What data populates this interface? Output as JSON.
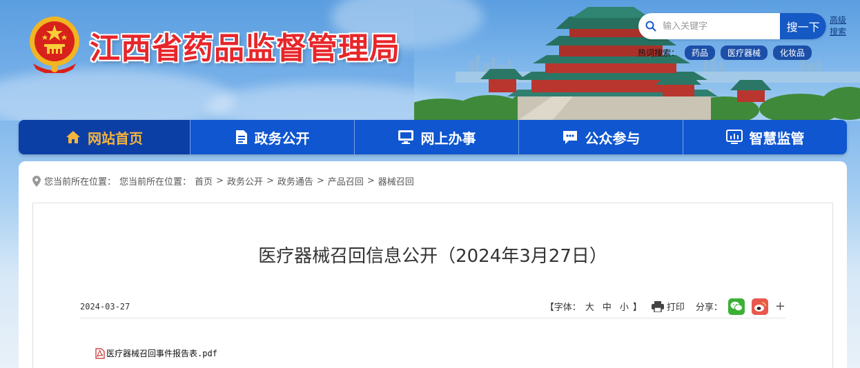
{
  "header": {
    "site_title": "江西省药品监督管理局",
    "search": {
      "placeholder": "输入关键字",
      "button": "搜一下"
    },
    "advanced_search": "高级搜索",
    "hot": {
      "label": "热词搜索：",
      "tags": [
        "药品",
        "医疗器械",
        "化妆品"
      ]
    }
  },
  "nav": {
    "items": [
      {
        "label": "网站首页",
        "icon": "home-icon"
      },
      {
        "label": "政务公开",
        "icon": "document-icon"
      },
      {
        "label": "网上办事",
        "icon": "monitor-icon"
      },
      {
        "label": "公众参与",
        "icon": "chat-icon"
      },
      {
        "label": "智慧监管",
        "icon": "dashboard-icon"
      }
    ]
  },
  "breadcrumb": {
    "prefix": "您当前所在位置：",
    "prefix2": "您当前所在位置：",
    "items": [
      "首页",
      "政务公开",
      "政务通告",
      "产品召回",
      "器械召回"
    ],
    "separator": ">"
  },
  "article": {
    "title": "医疗器械召回信息公开（2024年3月27日）",
    "date": "2024-03-27",
    "font_size": {
      "open": "【字体：",
      "large": "大",
      "medium": "中",
      "small": "小",
      "close": "】"
    },
    "print": "打印",
    "share": "分享：",
    "more": "+",
    "attachment": "医疗器械召回事件报告表.pdf"
  },
  "colors": {
    "nav_bg": "#0f56d0",
    "nav_active": "#0b3fa6",
    "title_red": "#e7262a",
    "wechat": "#3cb034",
    "weibo": "#e8584d"
  }
}
